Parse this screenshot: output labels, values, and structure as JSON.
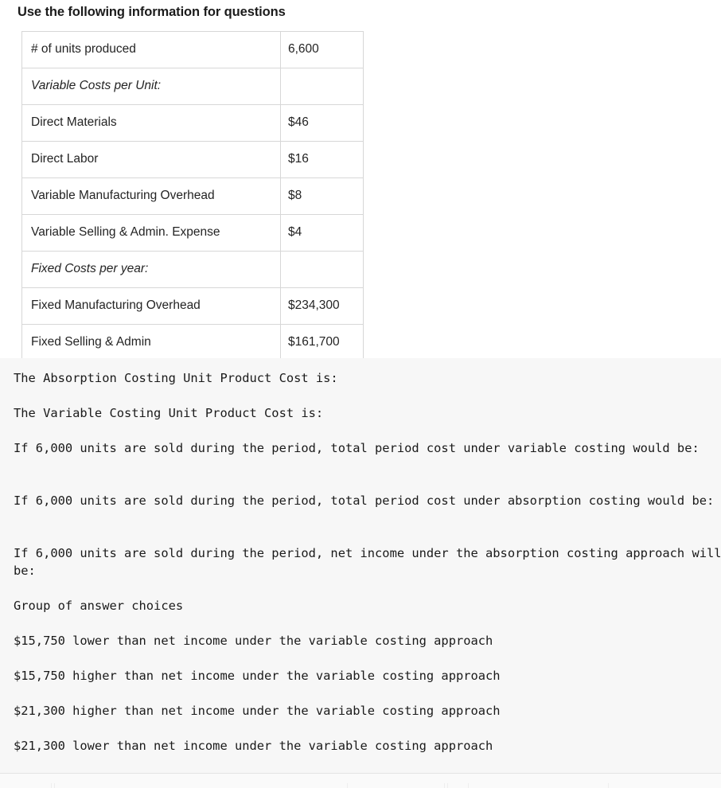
{
  "heading": "Use the following information for questions",
  "table": {
    "rows": [
      {
        "label": "# of units produced",
        "value": "6,600",
        "section": false
      },
      {
        "label": "Variable Costs per Unit:",
        "value": "",
        "section": true
      },
      {
        "label": "Direct Materials",
        "value": "$46",
        "section": false
      },
      {
        "label": "Direct Labor",
        "value": "$16",
        "section": false
      },
      {
        "label": "Variable Manufacturing Overhead",
        "value": "$8",
        "section": false
      },
      {
        "label": "Variable Selling & Admin. Expense",
        "value": "$4",
        "section": false
      },
      {
        "label": "Fixed Costs per year:",
        "value": "",
        "section": true
      },
      {
        "label": "Fixed Manufacturing Overhead",
        "value": "$234,300",
        "section": false
      },
      {
        "label": "Fixed Selling & Admin",
        "value": "$161,700",
        "section": false
      }
    ]
  },
  "questions": [
    "The Absorption Costing Unit Product Cost is:",
    "The Variable Costing Unit Product Cost is:",
    "If 6,000 units are sold during the period, total period cost under variable costing would be:",
    "If 6,000 units are sold during the period, total period cost under absorption costing would be:",
    "If 6,000 units are sold during the period, net income under the absorption costing approach will be:"
  ],
  "answer_choices_label": "Group of answer choices",
  "answer_choices": [
    "$15,750 lower than net income under the variable costing approach",
    "$15,750 higher than net income under the variable costing approach",
    "$21,300 higher than net income under the variable costing approach",
    "$21,300 lower than net income under the variable costing approach"
  ],
  "colors": {
    "page_background": "#ffffff",
    "question_background": "#f7f7f7",
    "table_border": "#d7d7d7",
    "text": "#1a1a1a",
    "divider": "#e4e4e4"
  }
}
